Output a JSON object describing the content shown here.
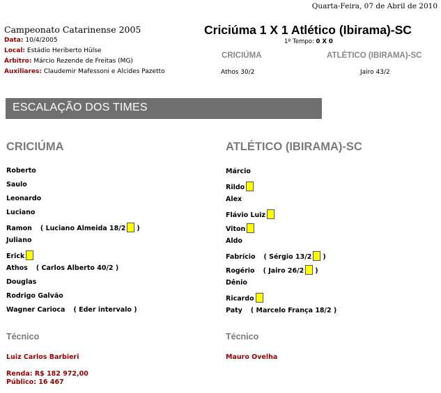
{
  "date_line": "Quarta-Feira, 07 de Abril de 2010",
  "competition": "Campeonato Catarinense 2005",
  "info": {
    "data_label": "Data:",
    "data_value": "10/4/2005",
    "local_label": "Local:",
    "local_value": "Estádio Heriberto Hülse",
    "arbitro_label": "Árbitro:",
    "arbitro_value": "Márcio Rezende de Freitas (MG)",
    "auxiliares_label": "Auxiliares:",
    "auxiliares_value": "Claudemir Mafessoni e Alcides Pazetto"
  },
  "match": {
    "score_line": "Criciúma 1 X 1 Atlético (Ibirama)-SC",
    "period_label": "1º Tempo:",
    "period_score": "0 X 0",
    "home_header": "CRICIÚMA",
    "away_header": "ATLÉTICO (IBIRAMA)-SC",
    "home_scorer": "Athos   30/2",
    "away_scorer": "Jairo   43/2"
  },
  "section_title": "ESCALAÇÃO DOS TIMES",
  "home": {
    "title": "CRICIÚMA",
    "players": [
      {
        "name": "Roberto",
        "sub": "",
        "card": false
      },
      {
        "name": "Saulo",
        "sub": "",
        "card": false
      },
      {
        "name": "Leonardo",
        "sub": "",
        "card": false
      },
      {
        "name": "Luciano",
        "sub": "",
        "card": false
      },
      {
        "name": "Ramon",
        "sub": "( Luciano Almeida 18/2",
        "sub_card": true,
        "card": false
      },
      {
        "name": "Juliano",
        "sub": "",
        "card": false
      },
      {
        "name": "Erick",
        "sub": "",
        "card": true
      },
      {
        "name": "Athos",
        "sub": "( Carlos Alberto 40/2 )",
        "card": false
      },
      {
        "name": "Douglas",
        "sub": "",
        "card": false
      },
      {
        "name": "Rodrigo Galvão",
        "sub": "",
        "card": false
      },
      {
        "name": "Wagner Carioca",
        "sub": "( Eder intervalo )",
        "card": false
      }
    ],
    "tecnico_label": "Técnico",
    "coach": "Luiz Carlos Barbieri"
  },
  "away": {
    "title": "ATLÉTICO (IBIRAMA)-SC",
    "players": [
      {
        "name": "Márcio",
        "sub": "",
        "card": false
      },
      {
        "name": "Rildo",
        "sub": "",
        "card": true
      },
      {
        "name": "Alex",
        "sub": "",
        "card": false
      },
      {
        "name": "Flávio Luiz",
        "sub": "",
        "card": true
      },
      {
        "name": "Viton",
        "sub": "",
        "card": true
      },
      {
        "name": "Aldo",
        "sub": "",
        "card": false
      },
      {
        "name": "Fabrício",
        "sub": "( Sérgio 13/2",
        "sub_card": true,
        "card": false
      },
      {
        "name": "Rogério",
        "sub": "( Jairo 26/2",
        "sub_card": true,
        "card": false
      },
      {
        "name": "Dênio",
        "sub": "",
        "card": false
      },
      {
        "name": "Ricardo",
        "sub": "",
        "card": true
      },
      {
        "name": "Paty",
        "sub": "( Marcelo França 18/2 )",
        "card": false
      }
    ],
    "tecnico_label": "Técnico",
    "coach": "Mauro Ovelha"
  },
  "finance": {
    "renda": "Renda: R$ 182 972,00",
    "publico": "Público: 16 467"
  },
  "colors": {
    "label_red": "#990000",
    "bar_gray": "#6f6f6f",
    "header_gray": "#7a7a7a",
    "card_yellow": "#ffff00"
  }
}
